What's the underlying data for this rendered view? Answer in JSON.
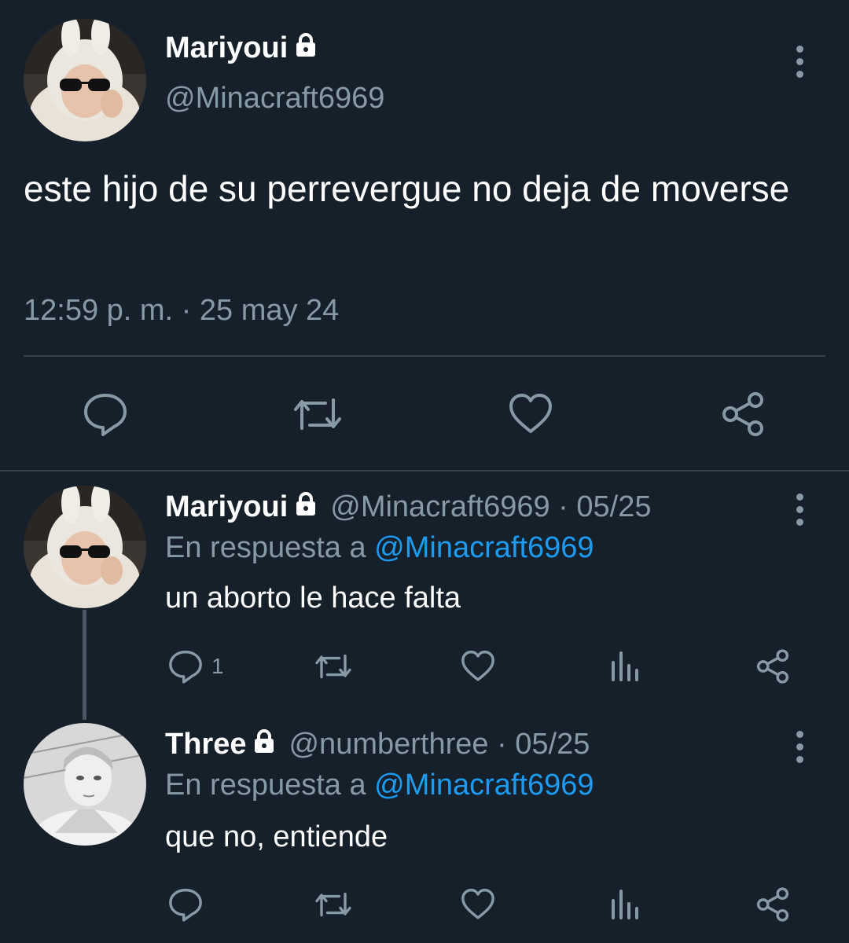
{
  "main_tweet": {
    "display_name": "Mariyoui",
    "handle": "@Minacraft6969",
    "text": "este hijo de su perrevergue no deja de moverse",
    "timestamp": "12:59 p. m. · 25 may 24",
    "actions": [
      "reply-icon",
      "retweet-icon",
      "like-icon",
      "share-icon"
    ]
  },
  "replies": [
    {
      "display_name": "Mariyoui",
      "handle_date": "@Minacraft6969 · 05/25",
      "reply_prefix": "En respuesta a",
      "reply_to": "@Minacraft6969",
      "text": "un aborto le hace falta",
      "reply_count": "1"
    },
    {
      "display_name": "Three",
      "handle_date": "@numberthree · 05/25",
      "reply_prefix": "En respuesta a",
      "reply_to": "@Minacraft6969",
      "text": "que no, entiende",
      "reply_count": ""
    }
  ],
  "colors": {
    "background": "#15202b",
    "muted": "#8899a6",
    "link": "#1d9bf0",
    "divider": "#38444d"
  }
}
